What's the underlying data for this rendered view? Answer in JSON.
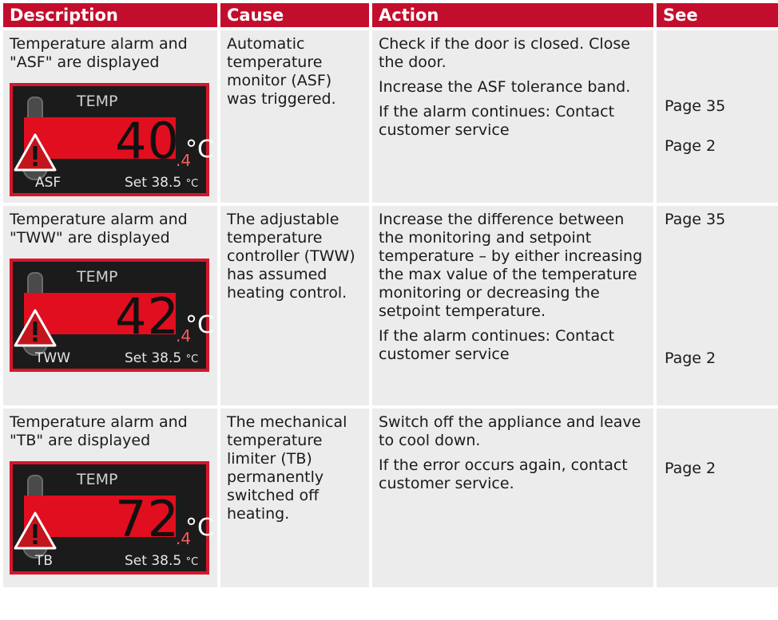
{
  "header": {
    "description": "Description",
    "cause": "Cause",
    "action": "Action",
    "see": "See"
  },
  "rows": [
    {
      "description": "Temperature alarm and \"ASF\" are displayed",
      "cause": "Automatic temperature monitor (ASF) was triggered.",
      "actions": [
        "Check if the door is closed. Close the door.",
        "Increase the ASF tolerance band.",
        "If the alarm continues: Contact customer service"
      ],
      "see": [
        "Page 35",
        "Page 2"
      ],
      "display": {
        "temp_label": "TEMP",
        "value": "40",
        "decimal": ".4",
        "unit": "°C",
        "mode": "ASF",
        "set_text": "Set 38.5",
        "set_unit": "°C",
        "icon": "warning-triangle-icon"
      }
    },
    {
      "description": "Temperature alarm and \"TWW\" are displayed",
      "cause": "The adjustable temperature controller (TWW) has assumed heating control.",
      "actions": [
        "Increase the difference between the monitoring and setpoint temperature – by either increasing the max value of the temperature monitoring or decreasing the setpoint temperature.",
        "If the alarm continues: Contact customer service"
      ],
      "see": [
        "Page 35",
        "Page 2"
      ],
      "display": {
        "temp_label": "TEMP",
        "value": "42",
        "decimal": ".4",
        "unit": "°C",
        "mode": "TWW",
        "set_text": "Set 38.5",
        "set_unit": "°C",
        "icon": "warning-triangle-icon"
      }
    },
    {
      "description": "Temperature alarm and \"TB\" are displayed",
      "cause": "The mechanical temperature limiter (TB) permanently switched off heating.",
      "actions": [
        "Switch off the appliance and leave to cool down.",
        "If the error occurs again, contact customer service."
      ],
      "see": [
        "Page 2"
      ],
      "display": {
        "temp_label": "TEMP",
        "value": "72",
        "decimal": ".4",
        "unit": "°C",
        "mode": "TB",
        "set_text": "Set 38.5",
        "set_unit": "°C",
        "icon": "warning-triangle-icon"
      }
    }
  ]
}
